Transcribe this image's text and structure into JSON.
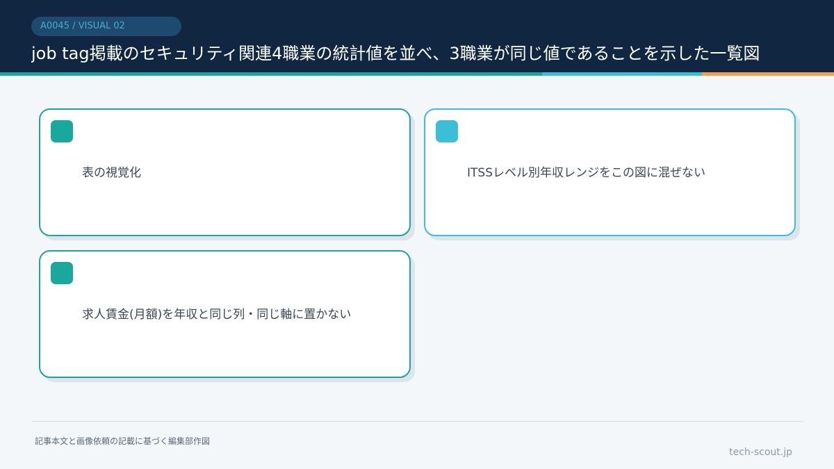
{
  "header": {
    "badge": "A0045 / VISUAL 02",
    "title": "job tag掲載のセキュリティ関連4職業の統計値を並べ、3職業が同じ値であることを示した一覧図"
  },
  "cards": [
    {
      "text": "表の視覚化"
    },
    {
      "text": "ITSSレベル別年収レンジをこの図に混ぜない"
    },
    {
      "text": "求人賃金(月額)を年収と同じ列・同じ軸に置かない"
    }
  ],
  "footer": {
    "note": "記事本文と画像依頼の記載に基づく編集部作図",
    "site": "tech-scout.jp"
  },
  "colors": {
    "header_bg": "#112640",
    "teal": "#1fa39a",
    "cyan": "#3bbfd9",
    "orange": "#f0a24a"
  }
}
